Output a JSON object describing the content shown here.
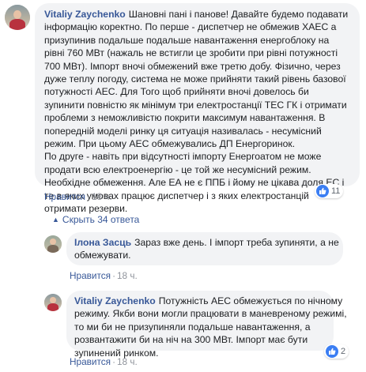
{
  "comments": [
    {
      "author": "Vitaliy Zaychenko",
      "lines": [
        "Шановні пані і панове! Давайте будемо подавати",
        "інформацію коректно. По перше - диспетчер не обмежив ХАЕС а",
        "призупинив подальше подальше навантаження енергоблоку на",
        "рівні 760 МВт (нажаль не встигли це зробити при рівні потужності",
        "700 МВт). Імпорт вночі обмежений вже третю добу. Фізично, через",
        "дуже теплу погоду, система не може прийняти такий рівень базової",
        "потужності АЕС. Для Того щоб прийняти вночі довелось би",
        "зупинити повністю як мінімум три електростанції ТЕС ГК і отримати",
        "проблеми з неможливістю покрити максимум навантаження. В",
        "попередній моделі ринку ця ситуація називалась - несумісний",
        "режим. При цьому АЕС обмежувались ДП Енергоринок.",
        "По друге - навіть при відсутності імпорту Енергоатом не може",
        "продати всю електроенергію - це той же несумісний режим.",
        "Необхідне обмеження. Але ЕА не є ППБ і йому не цікава доля ЕС і",
        "те в яких умовах працює диспетчер і з яких електростанцій",
        "отримати резерви."
      ],
      "like_label": "Нравится",
      "time": "18 ч.",
      "reaction_count": "11"
    },
    {
      "author": "Ілона Засць",
      "lines": [
        "Зараз вже день. І імпорт треба зупиняти, а не",
        "обмежувати."
      ],
      "like_label": "Нравится",
      "time": "18 ч."
    },
    {
      "author": "Vitaliy Zaychenko",
      "lines": [
        "Потужність АЕС обмежується по нічному",
        "режиму. Якби вони могли працювати в маневреному режимі,",
        "то ми би не призупиняли подальше навантаження, а",
        "розвантажити би на ніч на 300 МВт. Імпорт має бути",
        "зупинений ринком."
      ],
      "like_label": "Нравится",
      "time": "18 ч.",
      "reaction_count": "2"
    }
  ],
  "replies_toggle": "Скрыть 34 ответа",
  "icons": [
    "like-icon",
    "chevron-up-icon",
    "avatar"
  ],
  "colors": {
    "link": "#385898",
    "bubble": "#f2f3f5",
    "like_blue": "#3b7ef3",
    "muted": "#90949c"
  }
}
